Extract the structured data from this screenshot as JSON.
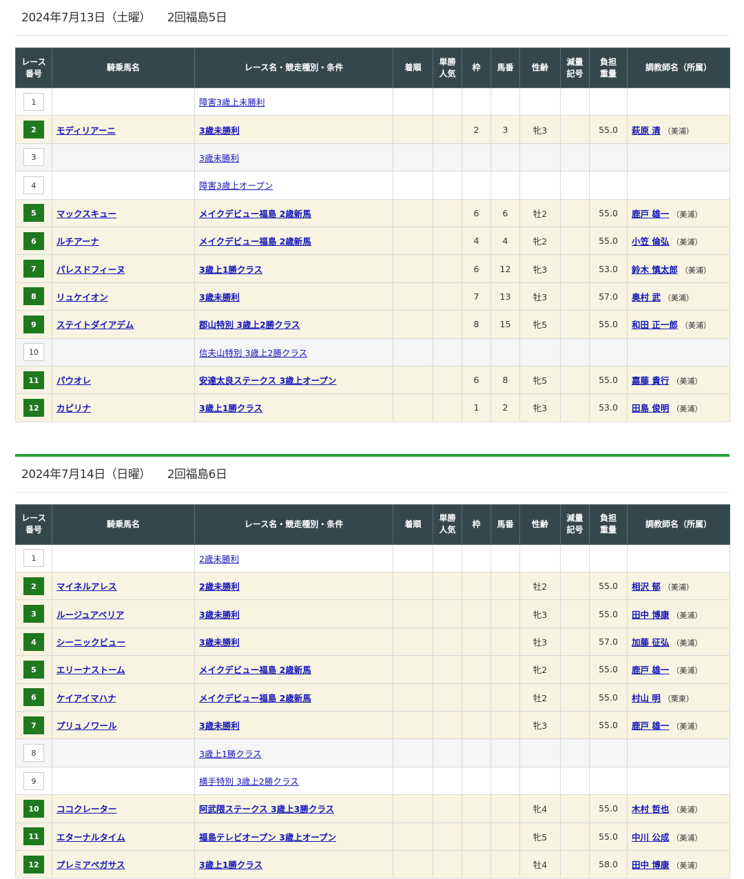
{
  "headers": [
    "レース\n番号",
    "騎乗馬名",
    "レース名・競走種別・条件",
    "着順",
    "単勝\n人気",
    "枠",
    "馬番",
    "性齢",
    "減量\n記号",
    "負担\n重量",
    "調教師名（所属）"
  ],
  "days": [
    {
      "date": "2024年7月13日（土曜）",
      "meet": "2回福島5日",
      "races": [
        {
          "no": "1",
          "horse": "",
          "race": "障害3歳上未勝利",
          "rank": "",
          "pop": "",
          "waku": "",
          "umaban": "",
          "sexage": "",
          "gen": "",
          "weight": "",
          "trainer": "",
          "aff": ""
        },
        {
          "no": "2",
          "horse": "モディリアーニ",
          "race": "3歳未勝利",
          "rank": "",
          "pop": "",
          "waku": "2",
          "umaban": "3",
          "sexage": "牝3",
          "gen": "",
          "weight": "55.0",
          "trainer": "萩原 清",
          "aff": "（美浦）"
        },
        {
          "no": "3",
          "horse": "",
          "race": "3歳未勝利",
          "rank": "",
          "pop": "",
          "waku": "",
          "umaban": "",
          "sexage": "",
          "gen": "",
          "weight": "",
          "trainer": "",
          "aff": ""
        },
        {
          "no": "4",
          "horse": "",
          "race": "障害3歳上オープン",
          "rank": "",
          "pop": "",
          "waku": "",
          "umaban": "",
          "sexage": "",
          "gen": "",
          "weight": "",
          "trainer": "",
          "aff": ""
        },
        {
          "no": "5",
          "horse": "マックスキュー",
          "race": "メイクデビュー福島 2歳新馬",
          "rank": "",
          "pop": "",
          "waku": "6",
          "umaban": "6",
          "sexage": "牡2",
          "gen": "",
          "weight": "55.0",
          "trainer": "鹿戸 雄一",
          "aff": "（美浦）"
        },
        {
          "no": "6",
          "horse": "ルチアーナ",
          "race": "メイクデビュー福島 2歳新馬",
          "rank": "",
          "pop": "",
          "waku": "4",
          "umaban": "4",
          "sexage": "牝2",
          "gen": "",
          "weight": "55.0",
          "trainer": "小笠 倫弘",
          "aff": "（美浦）"
        },
        {
          "no": "7",
          "horse": "パレスドフィーヌ",
          "race": "3歳上1勝クラス",
          "rank": "",
          "pop": "",
          "waku": "6",
          "umaban": "12",
          "sexage": "牝3",
          "gen": "",
          "weight": "53.0",
          "trainer": "鈴木 慎太郎",
          "aff": "（美浦）"
        },
        {
          "no": "8",
          "horse": "リュケイオン",
          "race": "3歳未勝利",
          "rank": "",
          "pop": "",
          "waku": "7",
          "umaban": "13",
          "sexage": "牡3",
          "gen": "",
          "weight": "57.0",
          "trainer": "奥村 武",
          "aff": "（美浦）"
        },
        {
          "no": "9",
          "horse": "ステイトダイアデム",
          "race": "郡山特別 3歳上2勝クラス",
          "rank": "",
          "pop": "",
          "waku": "8",
          "umaban": "15",
          "sexage": "牝5",
          "gen": "",
          "weight": "55.0",
          "trainer": "和田 正一郎",
          "aff": "（美浦）"
        },
        {
          "no": "10",
          "horse": "",
          "race": "信夫山特別 3歳上2勝クラス",
          "rank": "",
          "pop": "",
          "waku": "",
          "umaban": "",
          "sexage": "",
          "gen": "",
          "weight": "",
          "trainer": "",
          "aff": ""
        },
        {
          "no": "11",
          "horse": "パウオレ",
          "race": "安達太良ステークス 3歳上オープン",
          "rank": "",
          "pop": "",
          "waku": "6",
          "umaban": "8",
          "sexage": "牝5",
          "gen": "",
          "weight": "55.0",
          "trainer": "嘉藤 貴行",
          "aff": "（美浦）"
        },
        {
          "no": "12",
          "horse": "カピリナ",
          "race": "3歳上1勝クラス",
          "rank": "",
          "pop": "",
          "waku": "1",
          "umaban": "2",
          "sexage": "牝3",
          "gen": "",
          "weight": "53.0",
          "trainer": "田島 俊明",
          "aff": "（美浦）"
        }
      ]
    },
    {
      "date": "2024年7月14日（日曜）",
      "meet": "2回福島6日",
      "races": [
        {
          "no": "1",
          "horse": "",
          "race": "2歳未勝利",
          "rank": "",
          "pop": "",
          "waku": "",
          "umaban": "",
          "sexage": "",
          "gen": "",
          "weight": "",
          "trainer": "",
          "aff": ""
        },
        {
          "no": "2",
          "horse": "マイネルアレス",
          "race": "2歳未勝利",
          "rank": "",
          "pop": "",
          "waku": "",
          "umaban": "",
          "sexage": "牡2",
          "gen": "",
          "weight": "55.0",
          "trainer": "相沢 郁",
          "aff": "（美浦）"
        },
        {
          "no": "3",
          "horse": "ルージュアベリア",
          "race": "3歳未勝利",
          "rank": "",
          "pop": "",
          "waku": "",
          "umaban": "",
          "sexage": "牝3",
          "gen": "",
          "weight": "55.0",
          "trainer": "田中 博康",
          "aff": "（美浦）"
        },
        {
          "no": "4",
          "horse": "シーニックビュー",
          "race": "3歳未勝利",
          "rank": "",
          "pop": "",
          "waku": "",
          "umaban": "",
          "sexage": "牡3",
          "gen": "",
          "weight": "57.0",
          "trainer": "加藤 征弘",
          "aff": "（美浦）"
        },
        {
          "no": "5",
          "horse": "エリーナストーム",
          "race": "メイクデビュー福島 2歳新馬",
          "rank": "",
          "pop": "",
          "waku": "",
          "umaban": "",
          "sexage": "牝2",
          "gen": "",
          "weight": "55.0",
          "trainer": "鹿戸 雄一",
          "aff": "（美浦）"
        },
        {
          "no": "6",
          "horse": "ケイアイマハナ",
          "race": "メイクデビュー福島 2歳新馬",
          "rank": "",
          "pop": "",
          "waku": "",
          "umaban": "",
          "sexage": "牡2",
          "gen": "",
          "weight": "55.0",
          "trainer": "村山 明",
          "aff": "（栗東）"
        },
        {
          "no": "7",
          "horse": "プリュノワール",
          "race": "3歳未勝利",
          "rank": "",
          "pop": "",
          "waku": "",
          "umaban": "",
          "sexage": "牝3",
          "gen": "",
          "weight": "55.0",
          "trainer": "鹿戸 雄一",
          "aff": "（美浦）"
        },
        {
          "no": "8",
          "horse": "",
          "race": "3歳上1勝クラス",
          "rank": "",
          "pop": "",
          "waku": "",
          "umaban": "",
          "sexage": "",
          "gen": "",
          "weight": "",
          "trainer": "",
          "aff": ""
        },
        {
          "no": "9",
          "horse": "",
          "race": "横手特別 3歳上2勝クラス",
          "rank": "",
          "pop": "",
          "waku": "",
          "umaban": "",
          "sexage": "",
          "gen": "",
          "weight": "",
          "trainer": "",
          "aff": ""
        },
        {
          "no": "10",
          "horse": "ココクレーター",
          "race": "阿武隈ステークス 3歳上3勝クラス",
          "rank": "",
          "pop": "",
          "waku": "",
          "umaban": "",
          "sexage": "牝4",
          "gen": "",
          "weight": "55.0",
          "trainer": "木村 哲也",
          "aff": "（美浦）"
        },
        {
          "no": "11",
          "horse": "エターナルタイム",
          "race": "福島テレビオープン 3歳上オープン",
          "rank": "",
          "pop": "",
          "waku": "",
          "umaban": "",
          "sexage": "牝5",
          "gen": "",
          "weight": "55.0",
          "trainer": "中川 公成",
          "aff": "（美浦）"
        },
        {
          "no": "12",
          "horse": "プレミアペガサス",
          "race": "3歳上1勝クラス",
          "rank": "",
          "pop": "",
          "waku": "",
          "umaban": "",
          "sexage": "牡4",
          "gen": "",
          "weight": "58.0",
          "trainer": "田中 博康",
          "aff": "（美浦）"
        }
      ]
    }
  ]
}
